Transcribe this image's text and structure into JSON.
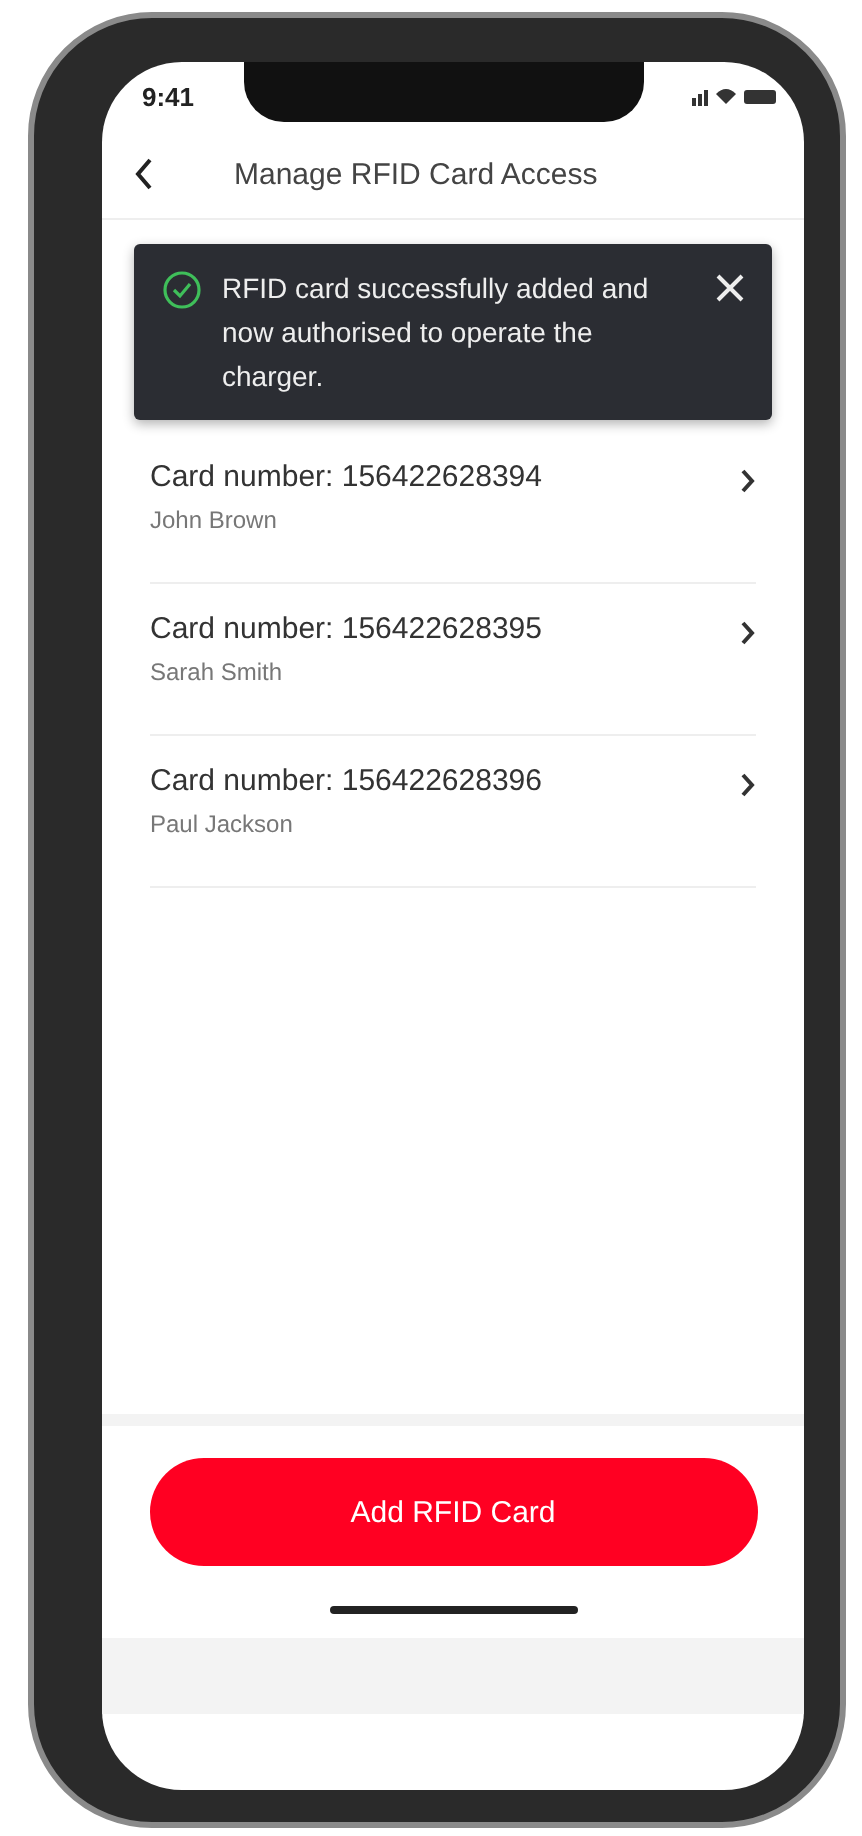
{
  "status_bar": {
    "time": "9:41"
  },
  "header": {
    "title": "Manage RFID Card Access"
  },
  "toast": {
    "message": "RFID card successfully added and now authorised to operate the charger."
  },
  "cards": [
    {
      "number": "Card number: 156422628394",
      "holder": "John Brown"
    },
    {
      "number": "Card number: 156422628395",
      "holder": "Sarah Smith"
    },
    {
      "number": "Card number: 156422628396",
      "holder": "Paul Jackson"
    }
  ],
  "primary_button": {
    "label": "Add RFID Card"
  }
}
